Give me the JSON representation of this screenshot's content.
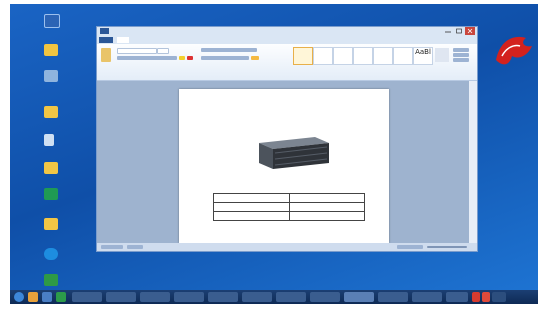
{
  "window": {
    "qat_text": "",
    "title": "",
    "controls": {
      "minimize": "minimize",
      "maximize": "maximize",
      "close": "close"
    }
  },
  "ribbon": {
    "tabs": [
      "",
      "",
      "",
      "",
      "",
      "",
      ""
    ],
    "style_gallery": [
      "",
      "",
      "",
      "",
      "",
      "",
      "AaBl",
      "",
      ""
    ]
  },
  "document": {
    "heading": "",
    "table": [
      [
        "",
        ""
      ],
      [
        "",
        ""
      ],
      [
        "",
        ""
      ]
    ]
  },
  "taskbar": {
    "clock": ""
  },
  "desktop": {
    "logo_text": ""
  },
  "colors": {
    "desktop_blue": "#1a64c4",
    "ribbon_file_tab": "#2b5797",
    "taskbar": "#0e2a55",
    "logo_red": "#d3221e"
  }
}
